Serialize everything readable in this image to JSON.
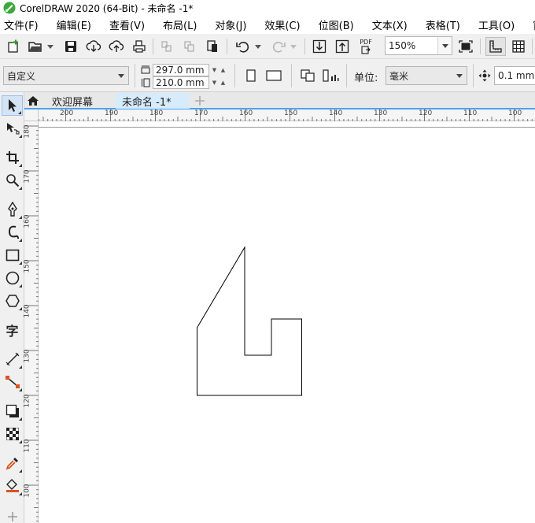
{
  "window": {
    "title": "CorelDRAW 2020 (64-Bit) - 未命名 -1*"
  },
  "menu": [
    "文件(F)",
    "编辑(E)",
    "查看(V)",
    "布局(L)",
    "对象(J)",
    "效果(C)",
    "位图(B)",
    "文本(X)",
    "表格(T)",
    "工具(O)",
    "窗口"
  ],
  "toolbar": {
    "zoom_value": "150%",
    "icons": [
      "new-document-icon",
      "open-icon",
      "save-icon",
      "cloud-import-icon",
      "cloud-export-icon",
      "print-icon",
      "cut-icon",
      "copy-icon",
      "paste-icon",
      "undo-icon",
      "redo-icon",
      "import-icon",
      "export-icon",
      "publish-pdf-icon",
      "full-screen-icon",
      "show-rulers-icon",
      "show-grid-icon"
    ],
    "pdf_label": "PDF"
  },
  "property_bar": {
    "page_preset": "自定义",
    "page_width": "297.0 mm",
    "page_height": "210.0 mm",
    "units_label": "单位:",
    "units_value": "毫米",
    "nudge_value": "0.1 mm"
  },
  "tabs": {
    "welcome": "欢迎屏幕",
    "document": "未命名 -1*"
  },
  "toolbox": {
    "tools": [
      "pick-tool",
      "shape-tool",
      "crop-tool",
      "zoom-tool",
      "freehand-tool",
      "artistic-media-tool",
      "rectangle-tool",
      "ellipse-tool",
      "polygon-tool",
      "text-tool",
      "dimension-tool",
      "connector-tool",
      "drop-shadow-tool",
      "transparency-tool",
      "eyedropper-tool",
      "interactive-fill-tool",
      "add-tool"
    ],
    "text_tool_glyph": "字"
  },
  "rulers": {
    "horizontal_labels": [
      "200",
      "190",
      "180",
      "170",
      "160",
      "150",
      "140",
      "130",
      "120",
      "110",
      "100"
    ],
    "vertical_labels": [
      "180",
      "170",
      "160",
      "150",
      "140",
      "130",
      "120",
      "110",
      "100"
    ]
  }
}
